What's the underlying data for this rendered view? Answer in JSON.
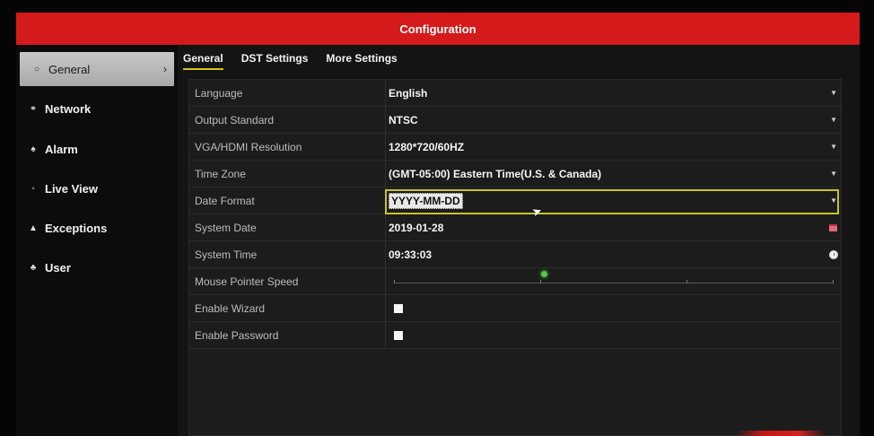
{
  "window": {
    "title": "Configuration"
  },
  "sidebar": {
    "items": [
      {
        "label": "General",
        "icon": "radio-ring-icon",
        "active": true
      },
      {
        "label": "Network",
        "icon": "network-icon"
      },
      {
        "label": "Alarm",
        "icon": "bell-icon"
      },
      {
        "label": "Live View",
        "icon": "eye-icon"
      },
      {
        "label": "Exceptions",
        "icon": "warning-icon"
      },
      {
        "label": "User",
        "icon": "users-icon"
      }
    ]
  },
  "tabs": [
    {
      "label": "General",
      "active": true
    },
    {
      "label": "DST Settings"
    },
    {
      "label": "More Settings"
    }
  ],
  "settings": {
    "language": {
      "label": "Language",
      "value": "English"
    },
    "output_standard": {
      "label": "Output Standard",
      "value": "NTSC"
    },
    "resolution": {
      "label": "VGA/HDMI Resolution",
      "value": "1280*720/60HZ"
    },
    "time_zone": {
      "label": "Time Zone",
      "value": "(GMT-05:00) Eastern Time(U.S. & Canada)"
    },
    "date_format": {
      "label": "Date Format",
      "value": "YYYY-MM-DD"
    },
    "system_date": {
      "label": "System Date",
      "value": "2019-01-28"
    },
    "system_time": {
      "label": "System Time",
      "value": "09:33:03"
    },
    "mouse_speed": {
      "label": "Mouse Pointer Speed",
      "level": 0.34
    },
    "enable_wizard": {
      "label": "Enable Wizard",
      "checked": false
    },
    "enable_password": {
      "label": "Enable Password",
      "checked": false
    }
  },
  "colors": {
    "title_bar": "#d41a1a",
    "tab_underline": "#d6c21a",
    "focus_border": "#c9c22a",
    "slider_knob": "#56c84a"
  }
}
